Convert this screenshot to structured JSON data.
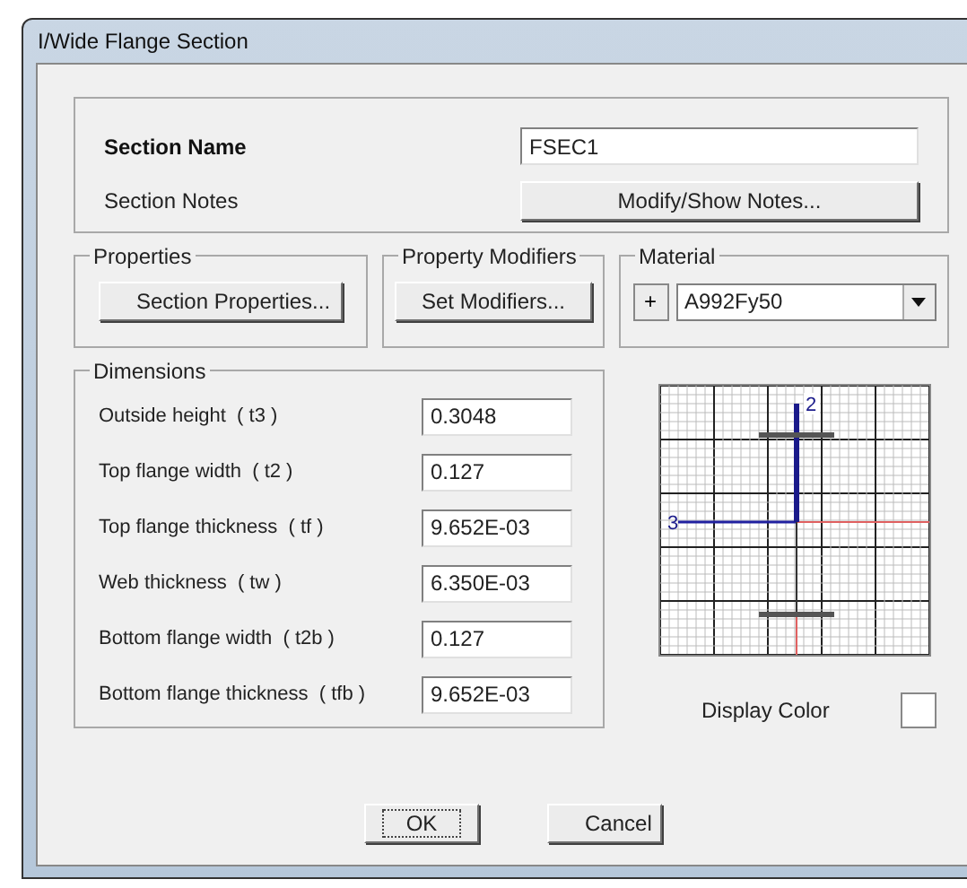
{
  "window": {
    "title": "I/Wide Flange Section"
  },
  "section_name": {
    "label": "Section Name",
    "value": "FSEC1"
  },
  "section_notes": {
    "label": "Section Notes",
    "button": "Modify/Show Notes..."
  },
  "properties": {
    "title": "Properties",
    "button": "Section Properties..."
  },
  "modifiers": {
    "title": "Property Modifiers",
    "button": "Set Modifiers..."
  },
  "material": {
    "title": "Material",
    "add_button": "+",
    "value": "A992Fy50"
  },
  "dimensions": {
    "title": "Dimensions",
    "rows": [
      {
        "label": "Outside height  ( t3 )",
        "value": "0.3048"
      },
      {
        "label": "Top flange width  ( t2 )",
        "value": "0.127"
      },
      {
        "label": "Top flange thickness  ( tf )",
        "value": "9.652E-03"
      },
      {
        "label": "Web thickness  ( tw )",
        "value": "6.350E-03"
      },
      {
        "label": "Bottom flange width  ( t2b )",
        "value": "0.127"
      },
      {
        "label": "Bottom flange thickness  ( tfb )",
        "value": "9.652E-03"
      }
    ]
  },
  "preview": {
    "axis_2": "2",
    "axis_3": "3"
  },
  "display_color": {
    "label": "Display Color"
  },
  "buttons": [
    {
      "label": "OK",
      "focused": true
    },
    {
      "label": "Cancel",
      "focused": false
    }
  ]
}
